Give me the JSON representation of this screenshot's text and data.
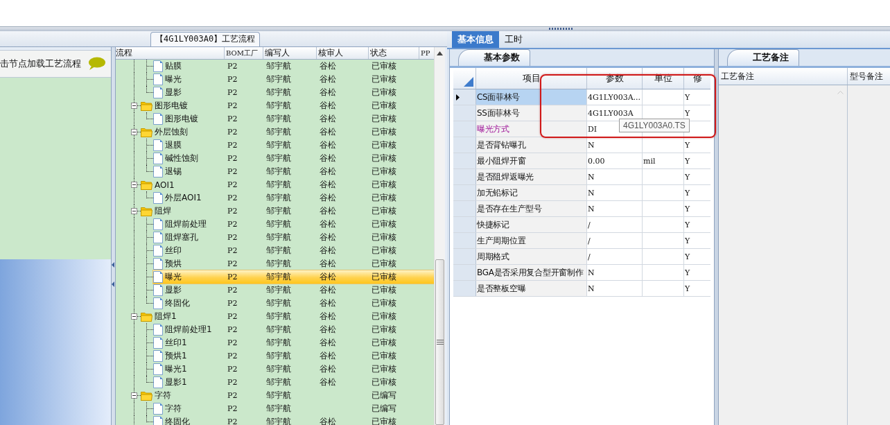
{
  "flow_panel": {
    "title": "【4G1LY003A0】工艺流程",
    "hint": "击节点加载工艺流程"
  },
  "tree": {
    "columns": [
      "流程",
      "BOM工厂",
      "编写人",
      "核审人",
      "状态",
      "PP"
    ],
    "continued_items": [
      {
        "label": "贴膜",
        "bom_factory": "P2",
        "author": "邹宇航",
        "reviewer": "谷松",
        "status": "已审核",
        "selected": false
      },
      {
        "label": "曝光",
        "bom_factory": "P2",
        "author": "邹宇航",
        "reviewer": "谷松",
        "status": "已审核",
        "selected": false
      },
      {
        "label": "显影",
        "bom_factory": "P2",
        "author": "邹宇航",
        "reviewer": "谷松",
        "status": "已审核",
        "selected": false
      }
    ],
    "nodes": [
      {
        "label": "图形电镀",
        "bom_factory": "P2",
        "author": "邹宇航",
        "reviewer": "谷松",
        "status": "已审核",
        "selected": false,
        "expanded": true,
        "children": [
          {
            "label": "图形电镀",
            "bom_factory": "P2",
            "author": "邹宇航",
            "reviewer": "谷松",
            "status": "已审核",
            "selected": false
          }
        ]
      },
      {
        "label": "外层蚀刻",
        "bom_factory": "P2",
        "author": "邹宇航",
        "reviewer": "谷松",
        "status": "已审核",
        "selected": false,
        "expanded": true,
        "children": [
          {
            "label": "退膜",
            "bom_factory": "P2",
            "author": "邹宇航",
            "reviewer": "谷松",
            "status": "已审核",
            "selected": false
          },
          {
            "label": "碱性蚀刻",
            "bom_factory": "P2",
            "author": "邹宇航",
            "reviewer": "谷松",
            "status": "已审核",
            "selected": false
          },
          {
            "label": "退锡",
            "bom_factory": "P2",
            "author": "邹宇航",
            "reviewer": "谷松",
            "status": "已审核",
            "selected": false
          }
        ]
      },
      {
        "label": "AOI1",
        "bom_factory": "P2",
        "author": "邹宇航",
        "reviewer": "谷松",
        "status": "已审核",
        "selected": false,
        "expanded": true,
        "children": [
          {
            "label": "外层AOI1",
            "bom_factory": "P2",
            "author": "邹宇航",
            "reviewer": "谷松",
            "status": "已审核",
            "selected": false
          }
        ]
      },
      {
        "label": "阻焊",
        "bom_factory": "P2",
        "author": "邹宇航",
        "reviewer": "谷松",
        "status": "已审核",
        "selected": false,
        "expanded": true,
        "children": [
          {
            "label": "阻焊前处理",
            "bom_factory": "P2",
            "author": "邹宇航",
            "reviewer": "谷松",
            "status": "已审核",
            "selected": false
          },
          {
            "label": "阻焊塞孔",
            "bom_factory": "P2",
            "author": "邹宇航",
            "reviewer": "谷松",
            "status": "已审核",
            "selected": false
          },
          {
            "label": "丝印",
            "bom_factory": "P2",
            "author": "邹宇航",
            "reviewer": "谷松",
            "status": "已审核",
            "selected": false
          },
          {
            "label": "预烘",
            "bom_factory": "P2",
            "author": "邹宇航",
            "reviewer": "谷松",
            "status": "已审核",
            "selected": false
          },
          {
            "label": "曝光",
            "bom_factory": "P2",
            "author": "邹宇航",
            "reviewer": "谷松",
            "status": "已审核",
            "selected": true
          },
          {
            "label": "显影",
            "bom_factory": "P2",
            "author": "邹宇航",
            "reviewer": "谷松",
            "status": "已审核",
            "selected": false
          },
          {
            "label": "终固化",
            "bom_factory": "P2",
            "author": "邹宇航",
            "reviewer": "谷松",
            "status": "已审核",
            "selected": false
          }
        ]
      },
      {
        "label": "阻焊1",
        "bom_factory": "P2",
        "author": "邹宇航",
        "reviewer": "谷松",
        "status": "已审核",
        "selected": false,
        "expanded": true,
        "children": [
          {
            "label": "阻焊前处理1",
            "bom_factory": "P2",
            "author": "邹宇航",
            "reviewer": "谷松",
            "status": "已审核",
            "selected": false
          },
          {
            "label": "丝印1",
            "bom_factory": "P2",
            "author": "邹宇航",
            "reviewer": "谷松",
            "status": "已审核",
            "selected": false
          },
          {
            "label": "预烘1",
            "bom_factory": "P2",
            "author": "邹宇航",
            "reviewer": "谷松",
            "status": "已审核",
            "selected": false
          },
          {
            "label": "曝光1",
            "bom_factory": "P2",
            "author": "邹宇航",
            "reviewer": "谷松",
            "status": "已审核",
            "selected": false
          },
          {
            "label": "显影1",
            "bom_factory": "P2",
            "author": "邹宇航",
            "reviewer": "谷松",
            "status": "已审核",
            "selected": false
          }
        ]
      },
      {
        "label": "字符",
        "bom_factory": "P2",
        "author": "邹宇航",
        "status": "已编写",
        "selected": false,
        "expanded": true,
        "children": [
          {
            "label": "字符",
            "bom_factory": "P2",
            "author": "邹宇航",
            "status": "已编写",
            "selected": false
          },
          {
            "label": "终固化",
            "bom_factory": "P2",
            "author": "邹宇航",
            "reviewer": "谷松",
            "status": "已审核",
            "selected": false
          }
        ]
      }
    ]
  },
  "info_tabs": [
    {
      "label": "基本信息",
      "selected": true
    },
    {
      "label": "工时",
      "selected": false
    }
  ],
  "params": {
    "tab": "基本参数",
    "columns": [
      "项目",
      "参数",
      "单位",
      "修"
    ],
    "rows": [
      {
        "item": "CS面菲林号",
        "value": "4G1LY003A...",
        "modified": "Y",
        "selected": true
      },
      {
        "item": "SS面菲林号",
        "value": "4G1LY003A",
        "modified": "Y",
        "selected": false
      },
      {
        "item": "曝光方式",
        "value": "DI",
        "highlighted": true,
        "selected": false
      },
      {
        "item": "是否背钻曝孔",
        "value": "N",
        "modified": "Y",
        "selected": false
      },
      {
        "item": "最小阻焊开窗",
        "value": "0.00",
        "unit": "mil",
        "modified": "Y",
        "selected": false
      },
      {
        "item": "是否阻焊返曝光",
        "value": "N",
        "modified": "Y",
        "selected": false
      },
      {
        "item": "加无铅标记",
        "value": "N",
        "modified": "Y",
        "selected": false
      },
      {
        "item": "是否存在生产型号",
        "value": "N",
        "modified": "Y",
        "selected": false
      },
      {
        "item": "快捷标记",
        "value": "/",
        "modified": "Y",
        "selected": false
      },
      {
        "item": "生产周期位置",
        "value": "/",
        "modified": "Y",
        "selected": false
      },
      {
        "item": "周期格式",
        "value": "/",
        "modified": "Y",
        "selected": false
      },
      {
        "item": "BGA是否采用复合型开窗制作",
        "value": "N",
        "modified": "Y",
        "selected": false
      },
      {
        "item": "是否整板空曝",
        "value": "N",
        "modified": "Y",
        "selected": false
      }
    ],
    "tooltip": "4G1LY003A0.TS"
  },
  "remarks": {
    "tab": "工艺备注",
    "columns": [
      "工艺备注",
      "型号备注"
    ]
  }
}
